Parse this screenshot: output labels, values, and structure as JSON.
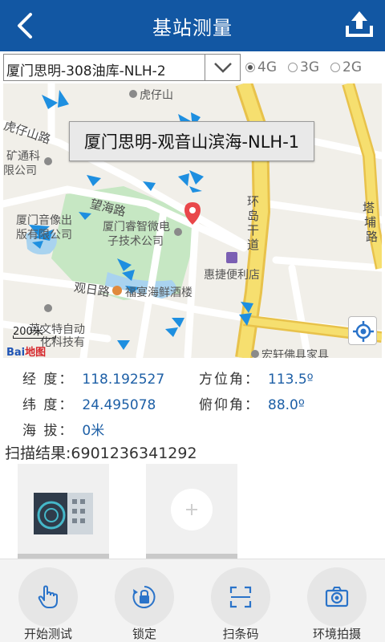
{
  "header": {
    "title": "基站测量"
  },
  "selector": {
    "value": "厦门思明-308油库-NLH-2",
    "network_options": [
      {
        "label": "4G",
        "selected": true
      },
      {
        "label": "3G",
        "selected": false
      },
      {
        "label": "2G",
        "selected": false
      }
    ]
  },
  "map": {
    "tooltip": "厦门思明-观音山滨海-NLH-1",
    "labels": {
      "poi1": "虎仔山",
      "road1": "虎仔山路",
      "poi2a": "矿通科",
      "poi2b": "限公司",
      "road2": "望海路",
      "poi3a": "厦门睿智微电",
      "poi3b": "子技术公司",
      "poi4a": "厦门音像出",
      "poi4b": "版有限公司",
      "road3a": "环",
      "road3b": "岛",
      "road3c": "干",
      "road3d": "道",
      "road4a": "塔",
      "road4b": "埔",
      "road4c": "路",
      "poi5": "惠捷便利店",
      "road5": "观日路",
      "poi6": "福宴海鲜酒楼",
      "poi7a": "英文特自动",
      "poi7b": "化科技有",
      "poi8": "宏轩佛具家具",
      "scale": "200米",
      "logo_a": "Bai",
      "logo_b": "地图"
    },
    "colors": {
      "antenna": "#1e8fe0",
      "major_road": "#f6df6f",
      "park": "#c6e7c3",
      "water": "#a9d3ef"
    }
  },
  "info": {
    "longitude_label": "经 度：",
    "longitude": "118.192527",
    "latitude_label": "纬 度：",
    "latitude": "24.495078",
    "altitude_label": "海 拔：",
    "altitude": "0米",
    "azimuth_label": "方位角：",
    "azimuth": "113.5º",
    "tilt_label": "俯仰角：",
    "tilt": "88.0º"
  },
  "scan": {
    "label": "扫描结果:",
    "value": "6901236341292"
  },
  "toolbar": {
    "items": [
      {
        "label": "开始测试",
        "icon": "hand-tap-icon"
      },
      {
        "label": "锁定",
        "icon": "lock-icon"
      },
      {
        "label": "扫条码",
        "icon": "barcode-scan-icon"
      },
      {
        "label": "环境拍摄",
        "icon": "camera-icon"
      }
    ]
  }
}
